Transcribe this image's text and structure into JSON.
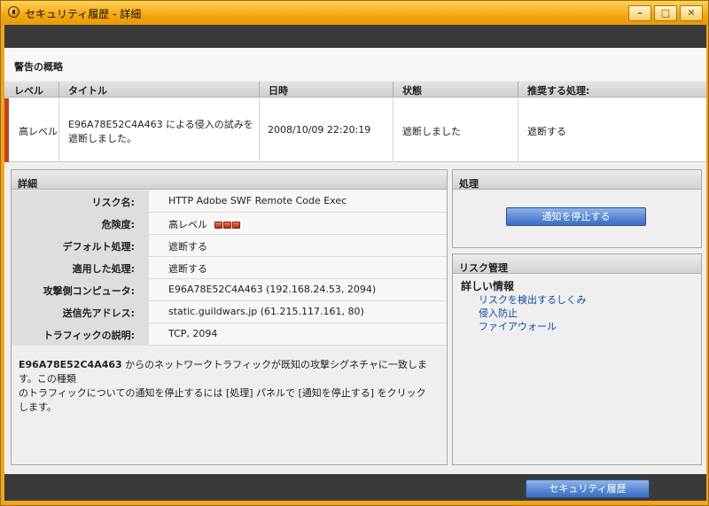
{
  "window": {
    "title": "セキュリティ履歴 - 詳細",
    "controls": {
      "minimize": "–",
      "maximize": "□",
      "close": "✕"
    }
  },
  "summary": {
    "heading": "警告の概略",
    "columns": [
      "レベル",
      "タイトル",
      "日時",
      "状態",
      "推奨する処理:"
    ],
    "row": {
      "level": "高レベル",
      "title_line1": "E96A78E52C4A463 による侵入の試みを",
      "title_line2": "遮断しました。",
      "datetime": "2008/10/09 22:20:19",
      "status": "遮断しました",
      "recommended": "遮断する"
    }
  },
  "details": {
    "heading": "詳細",
    "rows": [
      {
        "key": "リスク名:",
        "value": "HTTP Adobe SWF Remote Code Exec"
      },
      {
        "key": "危険度:",
        "value": "高レベル",
        "severity_level": 3
      },
      {
        "key": "デフォルト処理:",
        "value": "遮断する"
      },
      {
        "key": "適用した処理:",
        "value": "遮断する"
      },
      {
        "key": "攻撃側コンピュータ:",
        "value": "E96A78E52C4A463 (192.168.24.53, 2094)"
      },
      {
        "key": "送信先アドレス:",
        "value": "static.guildwars.jp (61.215.117.161, 80)"
      },
      {
        "key": "トラフィックの説明:",
        "value": "TCP, 2094"
      }
    ],
    "description_bold": "E96A78E52C4A463",
    "description_line1": " からのネットワークトラフィックが既知の攻撃シグネチャに一致します。この種類",
    "description_line2": "のトラフィックについての通知を停止するには [処理] パネルで [通知を停止する] をクリックします。"
  },
  "action": {
    "heading": "処理",
    "stop_button": "通知を停止する"
  },
  "risk": {
    "heading": "リスク管理",
    "info_title": "詳しい情報",
    "links": [
      "リスクを検出するしくみ",
      "侵入防止",
      "ファイアウォール"
    ]
  },
  "footer": {
    "history_button": "セキュリティ履歴"
  },
  "colors": {
    "frame": "#f0a51a",
    "dark_bar": "#3a3a3a",
    "severity": "#c2411c",
    "button_blue": "#5a8ad2",
    "link": "#0b4aa8"
  }
}
